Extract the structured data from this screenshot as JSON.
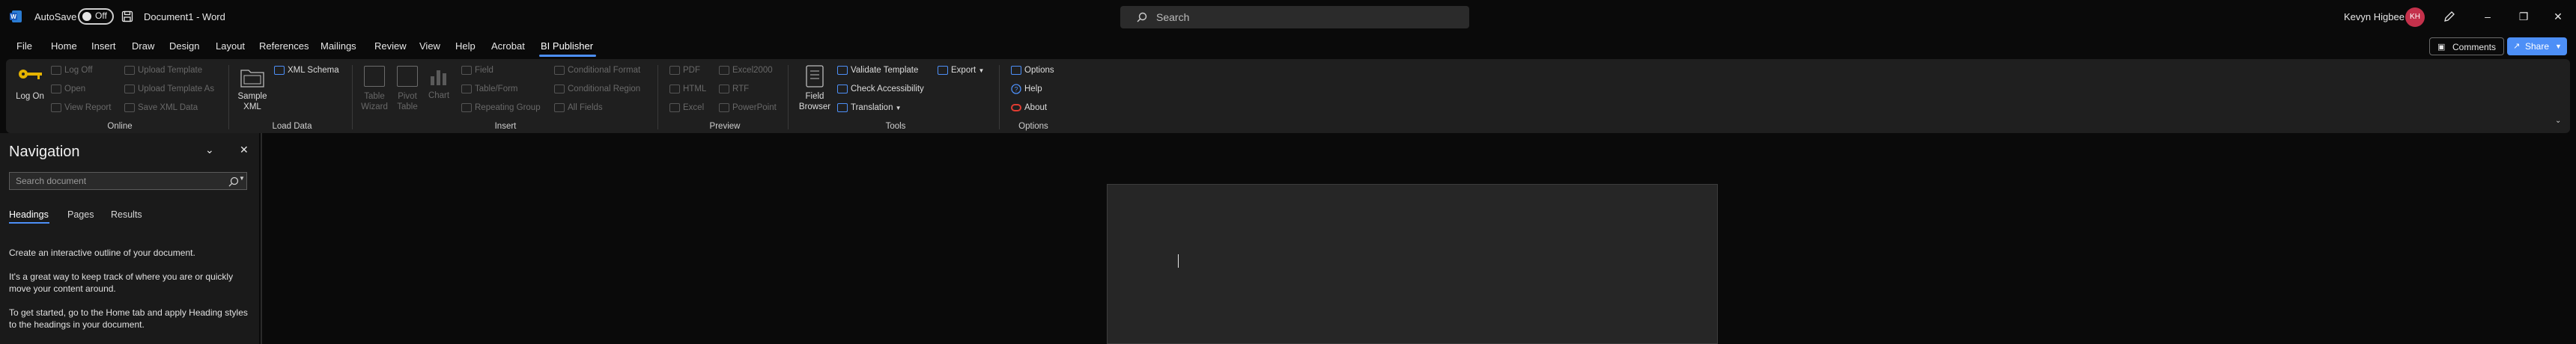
{
  "titlebar": {
    "autosave_label": "AutoSave",
    "autosave_state": "Off",
    "document_title": "Document1  -  Word",
    "search_placeholder": "Search",
    "user_name": "Kevyn Higbee",
    "user_initials": "KH"
  },
  "menu": {
    "tabs": [
      "File",
      "Home",
      "Insert",
      "Draw",
      "Design",
      "Layout",
      "References",
      "Mailings",
      "Review",
      "View",
      "Help",
      "Acrobat",
      "BI Publisher"
    ],
    "active_tab": "BI Publisher",
    "comments_label": "Comments",
    "share_label": "Share"
  },
  "ribbon": {
    "online": {
      "label": "Online",
      "log_on": "Log On",
      "log_off": "Log Off",
      "open": "Open",
      "view_report": "View Report",
      "upload_template": "Upload Template",
      "upload_template_as": "Upload Template As",
      "save_xml_data": "Save XML Data"
    },
    "load_data": {
      "label": "Load Data",
      "sample_xml": "Sample XML",
      "xml_schema": "XML Schema"
    },
    "insert": {
      "label": "Insert",
      "table_wizard": "Table Wizard",
      "pivot_table": "Pivot Table",
      "chart": "Chart",
      "field": "Field",
      "table_form": "Table/Form",
      "repeating_group": "Repeating Group",
      "conditional_format": "Conditional Format",
      "conditional_region": "Conditional Region",
      "all_fields": "All Fields"
    },
    "preview": {
      "label": "Preview",
      "pdf": "PDF",
      "html": "HTML",
      "excel": "Excel",
      "excel2000": "Excel2000",
      "rtf": "RTF",
      "powerpoint": "PowerPoint"
    },
    "tools": {
      "label": "Tools",
      "field_browser": "Field Browser",
      "validate_template": "Validate Template",
      "check_accessibility": "Check Accessibility",
      "translation": "Translation",
      "export": "Export"
    },
    "options": {
      "label": "Options",
      "options": "Options",
      "help": "Help",
      "about": "About"
    }
  },
  "navigation": {
    "title": "Navigation",
    "search_placeholder": "Search document",
    "tabs": [
      "Headings",
      "Pages",
      "Results"
    ],
    "active_tab": "Headings",
    "para1": "Create an interactive outline of your document.",
    "para2_line1": "It's a great way to keep track of where you are or quickly",
    "para2_line2": "move your content around.",
    "para3_line1": "To get started, go to the Home tab and apply Heading styles",
    "para3_line2": "to the headings in your document."
  },
  "colors": {
    "accent": "#4d8ff7",
    "avatar": "#c4314b",
    "ribbon_bg": "#1f1f1f",
    "page_bg": "#262626"
  }
}
